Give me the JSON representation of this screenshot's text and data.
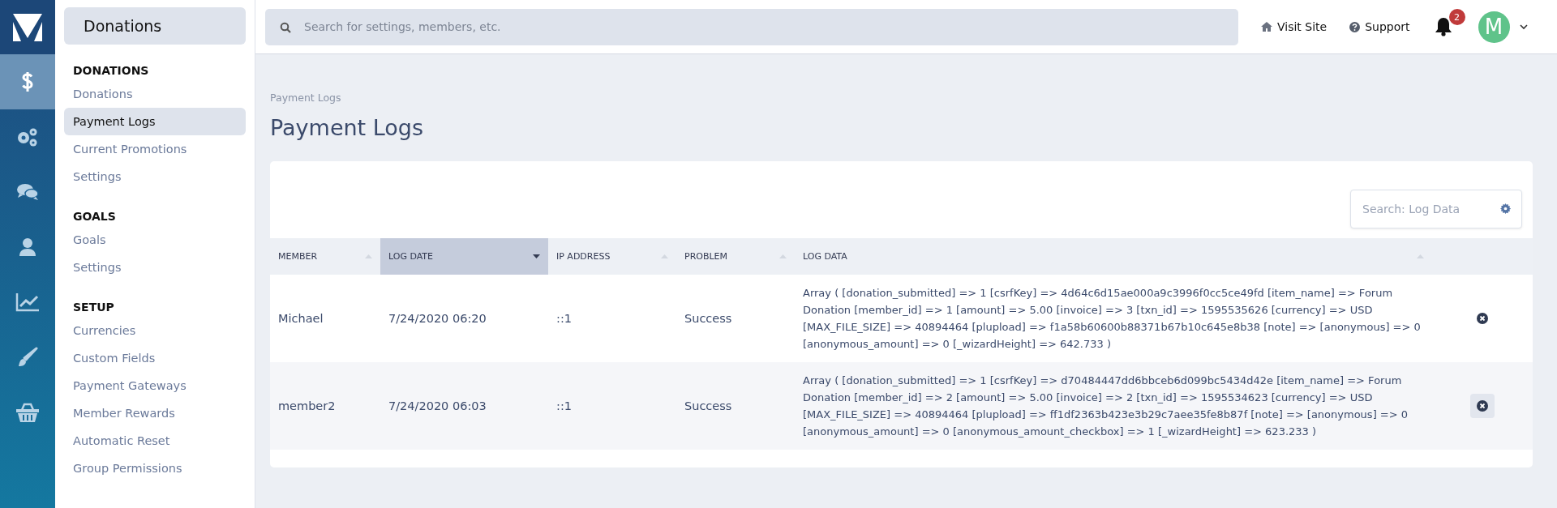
{
  "rail": [
    {
      "selected": true
    },
    {
      "selected": false
    },
    {
      "selected": false
    },
    {
      "selected": false
    },
    {
      "selected": false
    },
    {
      "selected": false
    },
    {
      "selected": false
    }
  ],
  "sidebar": {
    "title": "Donations",
    "sections": [
      {
        "heading": "DONATIONS",
        "items": [
          {
            "label": "Donations",
            "selected": false
          },
          {
            "label": "Payment Logs",
            "selected": true
          },
          {
            "label": "Current Promotions",
            "selected": false
          },
          {
            "label": "Settings",
            "selected": false
          }
        ]
      },
      {
        "heading": "GOALS",
        "items": [
          {
            "label": "Goals",
            "selected": false
          },
          {
            "label": "Settings",
            "selected": false
          }
        ]
      },
      {
        "heading": "SETUP",
        "items": [
          {
            "label": "Currencies",
            "selected": false
          },
          {
            "label": "Custom Fields",
            "selected": false
          },
          {
            "label": "Payment Gateways",
            "selected": false
          },
          {
            "label": "Member Rewards",
            "selected": false
          },
          {
            "label": "Automatic Reset",
            "selected": false
          },
          {
            "label": "Group Permissions",
            "selected": false
          }
        ]
      }
    ]
  },
  "topbar": {
    "search": {
      "placeholder": "Search for settings, members, etc."
    },
    "visit_site": "Visit Site",
    "support": "Support",
    "notifications": "2",
    "avatar": "M"
  },
  "breadcrumb": "Payment Logs",
  "title": "Payment Logs",
  "table": {
    "search": {
      "placeholder": "Search: Log Data"
    },
    "columns": [
      {
        "label": "MEMBER",
        "sorted": false
      },
      {
        "label": "LOG DATE",
        "sorted": true
      },
      {
        "label": "IP ADDRESS",
        "sorted": false
      },
      {
        "label": "PROBLEM",
        "sorted": false
      },
      {
        "label": "LOG DATA",
        "sorted": false
      }
    ],
    "rows": [
      {
        "member": "Michael",
        "date": "7/24/2020 06:20",
        "ip": "::1",
        "problem": "Success",
        "log": "Array ( [donation_submitted] => 1 [csrfKey] => 4d64c6d15ae000a9c3996f0cc5ce49fd [item_name] => Forum Donation [member_id] => 1 [amount] => 5.00 [invoice] => 3 [txn_id] => 1595535626 [currency] => USD [MAX_FILE_SIZE] => 40894464 [plupload] => f1a58b60600b88371b67b10c645e8b38 [note] => [anonymous] => 0 [anonymous_amount] => 0 [_wizardHeight] => 642.733 )",
        "hovered": false
      },
      {
        "member": "member2",
        "date": "7/24/2020 06:03",
        "ip": "::1",
        "problem": "Success",
        "log": "Array ( [donation_submitted] => 1 [csrfKey] => d70484447dd6bbceb6d099bc5434d42e [item_name] => Forum Donation [member_id] => 2 [amount] => 5.00 [invoice] => 2 [txn_id] => 1595534623 [currency] => USD [MAX_FILE_SIZE] => 40894464 [plupload] => ff1df2363b423e3b29c7aee35fe8b87f [note] => [anonymous] => 0 [anonymous_amount] => 0 [anonymous_amount_checkbox] => 1 [_wizardHeight] => 623.233 )",
        "hovered": true
      }
    ]
  }
}
